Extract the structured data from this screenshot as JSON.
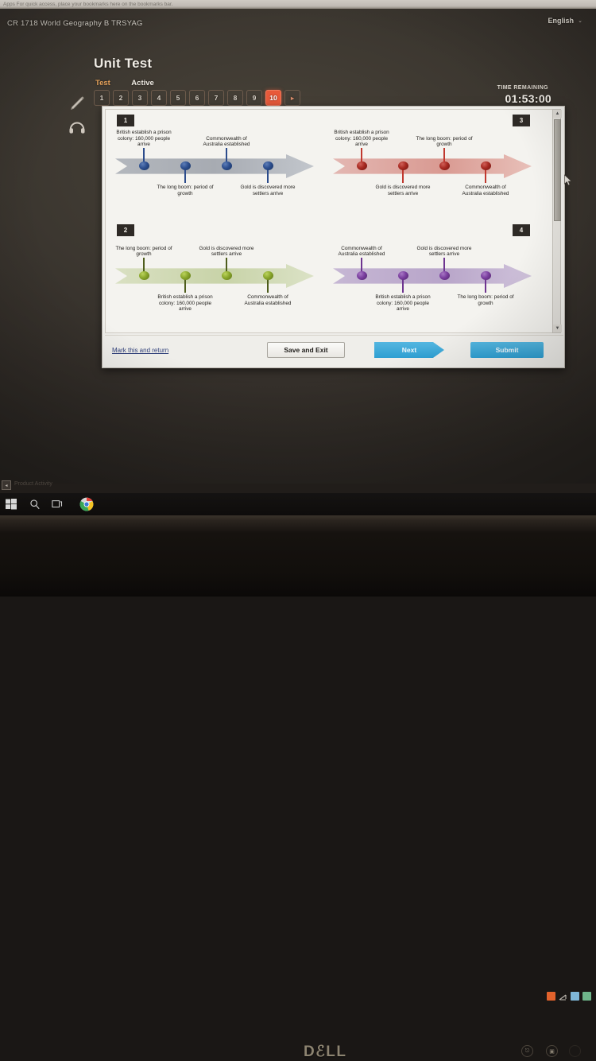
{
  "browser": {
    "bookmark_hint": "Apps     For quick access, place your bookmarks here on the bookmarks bar."
  },
  "header": {
    "course_title": "CR 1718 World Geography B TRSYAG",
    "language": "English",
    "language_caret": "⌄",
    "unit_title": "Unit Test",
    "status_test": "Test",
    "status_active": "Active",
    "timer_label": "TIME REMAINING",
    "timer_value": "01:53:00",
    "pencil_icon": "pencil-icon",
    "headphones_icon": "headphones-icon"
  },
  "question_nav": {
    "items": [
      "1",
      "2",
      "3",
      "4",
      "5",
      "6",
      "7",
      "8",
      "9",
      "10"
    ],
    "active_index": 9,
    "next_arrow": "▸"
  },
  "scrollbar": {
    "up_arrow": "▲",
    "down_arrow": "▼"
  },
  "events": {
    "prison": "British establish  a prison colony: 160,000 people arrive",
    "prison_alt": "British establish a prison colony: 160,000 people arrive",
    "boom": "The long boom: period of growth",
    "boom_one_line": "The long boom: period of growth",
    "gold": "Gold is discovered more settlers arrive",
    "gold_stacked": "Gold is discovered more settlers arrive",
    "commonwealth": "Commonwealth of Australia established"
  },
  "timelines": [
    {
      "number": "1",
      "badge_side": "left",
      "arrow_class": "ar-grey",
      "node_class": "nd-blue",
      "stem_class": "st-blue",
      "nodes": [
        {
          "label": "British establish  a prison colony: 160,000 people arrive",
          "position": "up"
        },
        {
          "label": "The long boom: period of growth",
          "position": "down"
        },
        {
          "label": "Commonwealth of Australia established",
          "position": "up"
        },
        {
          "label": "Gold is discovered more settlers arrive",
          "position": "down"
        }
      ]
    },
    {
      "number": "3",
      "badge_side": "right",
      "arrow_class": "ar-red",
      "node_class": "nd-red",
      "stem_class": "st-red",
      "nodes": [
        {
          "label": "British establish  a prison colony: 160,000 people arrive",
          "position": "up"
        },
        {
          "label": "Gold is discovered more settlers arrive",
          "position": "down"
        },
        {
          "label": "The long boom: period of growth",
          "position": "up"
        },
        {
          "label": "Commonwealth of Australia established",
          "position": "down"
        }
      ]
    },
    {
      "number": "2",
      "badge_side": "left",
      "arrow_class": "ar-green",
      "node_class": "nd-green",
      "stem_class": "st-green",
      "nodes": [
        {
          "label": "The long boom: period of growth",
          "position": "up"
        },
        {
          "label": "British establish a prison colony: 160,000 people arrive",
          "position": "down"
        },
        {
          "label": "Gold is discovered more settlers arrive",
          "position": "up"
        },
        {
          "label": "Commonwealth of Australia established",
          "position": "down"
        }
      ]
    },
    {
      "number": "4",
      "badge_side": "right",
      "arrow_class": "ar-purp",
      "node_class": "nd-purp",
      "stem_class": "st-purp",
      "nodes": [
        {
          "label": "Commonwealth of Australia established",
          "position": "up"
        },
        {
          "label": "British establish a prison colony: 160,000 people arrive",
          "position": "down"
        },
        {
          "label": "Gold is discovered more settlers arrive",
          "position": "up"
        },
        {
          "label": "The long boom: period of growth",
          "position": "down"
        }
      ]
    }
  ],
  "footer": {
    "mark_link": "Mark this and return",
    "save_label": "Save and Exit",
    "next_label": "Next",
    "submit_label": "Submit"
  },
  "taskbar": {
    "desktop_peek": "◂",
    "desktop_label": "Product Activity",
    "start_icon": "windows-start-icon",
    "search_icon": "search-icon",
    "taskview_icon": "task-view-icon",
    "chrome_icon": "chrome-icon"
  },
  "monitor": {
    "brand": "DℰLL",
    "input_button": "⎋",
    "menu_button": "▣"
  },
  "colors": {
    "accent_orange": "#e8593a",
    "button_blue": "#2e9fd2",
    "link_blue": "#2f3f7a",
    "timeline_1": "#2d4f8f",
    "timeline_2": "#8aa72c",
    "timeline_3": "#a82a22",
    "timeline_4": "#7b3fa0"
  }
}
